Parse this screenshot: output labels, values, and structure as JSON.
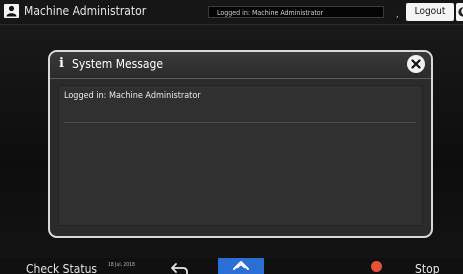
{
  "top_bar": {
    "title": "Machine Administrator",
    "login_status": "Logged in: Machine Administrator",
    "logout_label": "Logout",
    "separator_mark": ","
  },
  "dialog": {
    "title": "System Message",
    "info_glyph": "i",
    "message": "Logged in: Machine Administrator"
  },
  "bottom_bar": {
    "check_status_label": "Check Status",
    "date_text": "18 Jul, 2018",
    "stop_label": "Stop"
  },
  "icons": {
    "user": "user-icon",
    "energy_saver": "moon-icon",
    "info": "info-icon",
    "close": "close-icon",
    "back": "back-arrow-icon",
    "home": "home-icon",
    "stop": "stop-icon"
  },
  "colors": {
    "home_button": "#2a6fd6",
    "stop_icon": "#e8503a"
  }
}
